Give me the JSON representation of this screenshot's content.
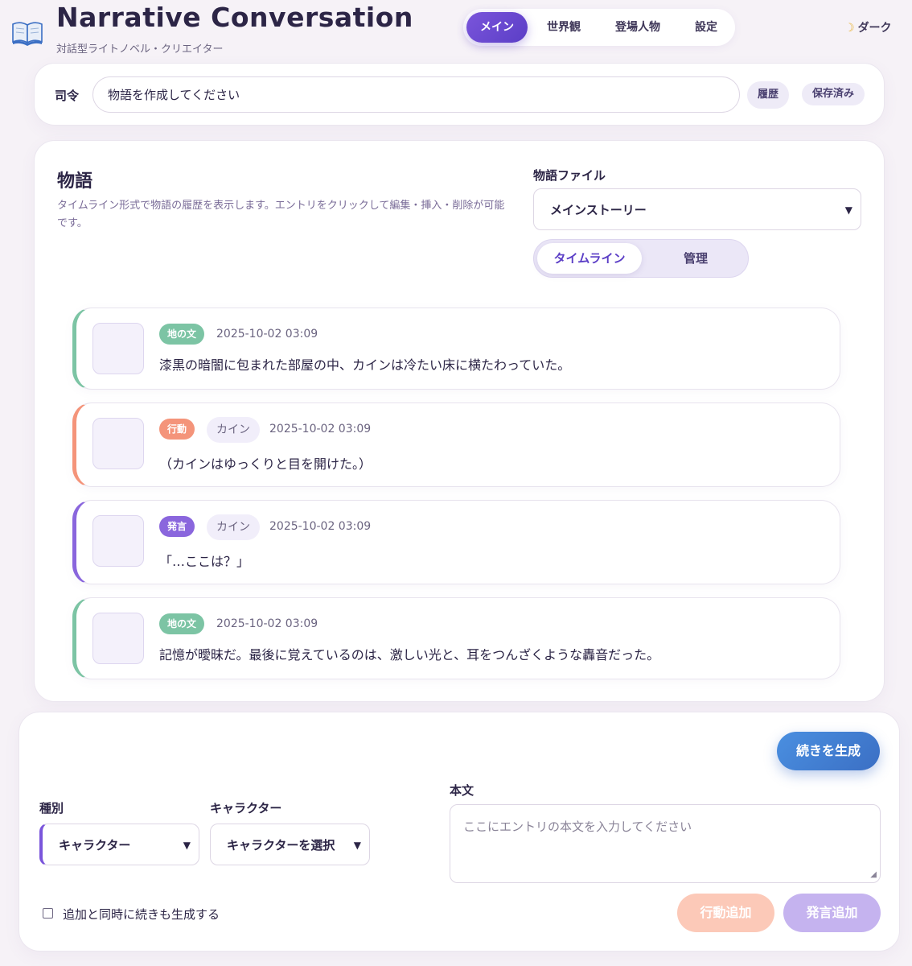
{
  "header": {
    "logo_icon": "open-book-icon",
    "title": "Narrative Conversation",
    "subtitle": "対話型ライトノベル・クリエイター",
    "nav": [
      {
        "label": "メイン",
        "active": true
      },
      {
        "label": "世界観",
        "active": false
      },
      {
        "label": "登場人物",
        "active": false
      },
      {
        "label": "設定",
        "active": false
      }
    ],
    "theme_icon": "moon-icon",
    "theme_label": "ダーク"
  },
  "command": {
    "label": "司令",
    "value": "物語を作成してください",
    "history_label": "履歴",
    "saved_label": "保存済み"
  },
  "story": {
    "heading": "物語",
    "description": "タイムライン形式で物語の履歴を表示します。エントリをクリックして編集・挿入・削除が可能です。",
    "file_label": "物語ファイル",
    "file_selected": "メインストーリー",
    "views": [
      {
        "label": "タイムライン",
        "active": true
      },
      {
        "label": "管理",
        "active": false
      }
    ],
    "entries": [
      {
        "tag": "地の文",
        "tag_color": "#7cc4a4",
        "character": "",
        "time": "2025-10-02 03:09",
        "text": "漆黒の暗闇に包まれた部屋の中、カインは冷たい床に横たわっていた。"
      },
      {
        "tag": "行動",
        "tag_color": "#f4947a",
        "character": "カイン",
        "time": "2025-10-02 03:09",
        "text": "（カインはゆっくりと目を開けた。）"
      },
      {
        "tag": "発言",
        "tag_color": "#8a66dd",
        "character": "カイン",
        "time": "2025-10-02 03:09",
        "text": "「…ここは？」"
      },
      {
        "tag": "地の文",
        "tag_color": "#7cc4a4",
        "character": "",
        "time": "2025-10-02 03:09",
        "text": "記憶が曖昧だ。最後に覚えているのは、激しい光と、耳をつんざくような轟音だった。"
      }
    ]
  },
  "composer": {
    "generate_label": "続きを生成",
    "type_label": "種別",
    "type_selected": "キャラクター",
    "character_label": "キャラクター",
    "character_selected": "キャラクターを選択",
    "body_label": "本文",
    "body_placeholder": "ここにエントリの本文を入力してください",
    "auto_generate_label": "追加と同時に続きも生成する",
    "auto_generate_checked": false,
    "add_action_label": "行動追加",
    "add_speech_label": "発言追加",
    "colors": {
      "action": "#fcc9b8",
      "speech": "#c5b3ef",
      "generate": "#3f7fd6"
    }
  }
}
